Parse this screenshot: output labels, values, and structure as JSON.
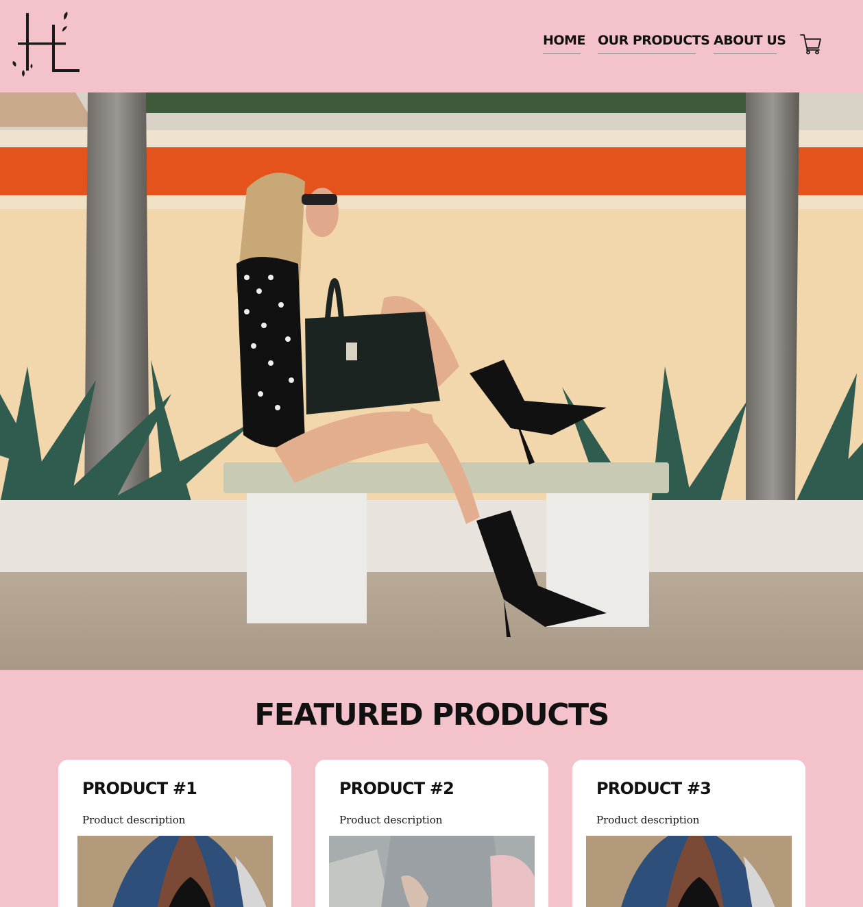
{
  "header": {
    "logo_name": "HL monogram logo",
    "nav": [
      {
        "label": "HOME"
      },
      {
        "label": "OUR PRODUCTS"
      },
      {
        "label": "ABOUT US"
      }
    ],
    "cart_icon": "shopping-cart-icon"
  },
  "hero": {
    "image": "woman-sitting-on-bench-with-handbag"
  },
  "featured": {
    "title": "FEATURED PRODUCTS",
    "products": [
      {
        "title": "PRODUCT #1",
        "description": "Product description",
        "image": "woman-in-denim-jacket"
      },
      {
        "title": "PRODUCT #2",
        "description": "Product description",
        "image": "hands-on-knees-fluffy-bag"
      },
      {
        "title": "PRODUCT #3",
        "description": "Product description",
        "image": "woman-in-denim-jacket"
      }
    ]
  },
  "colors": {
    "background": "#f4c2cb",
    "card": "#ffffff",
    "text": "#111111"
  }
}
